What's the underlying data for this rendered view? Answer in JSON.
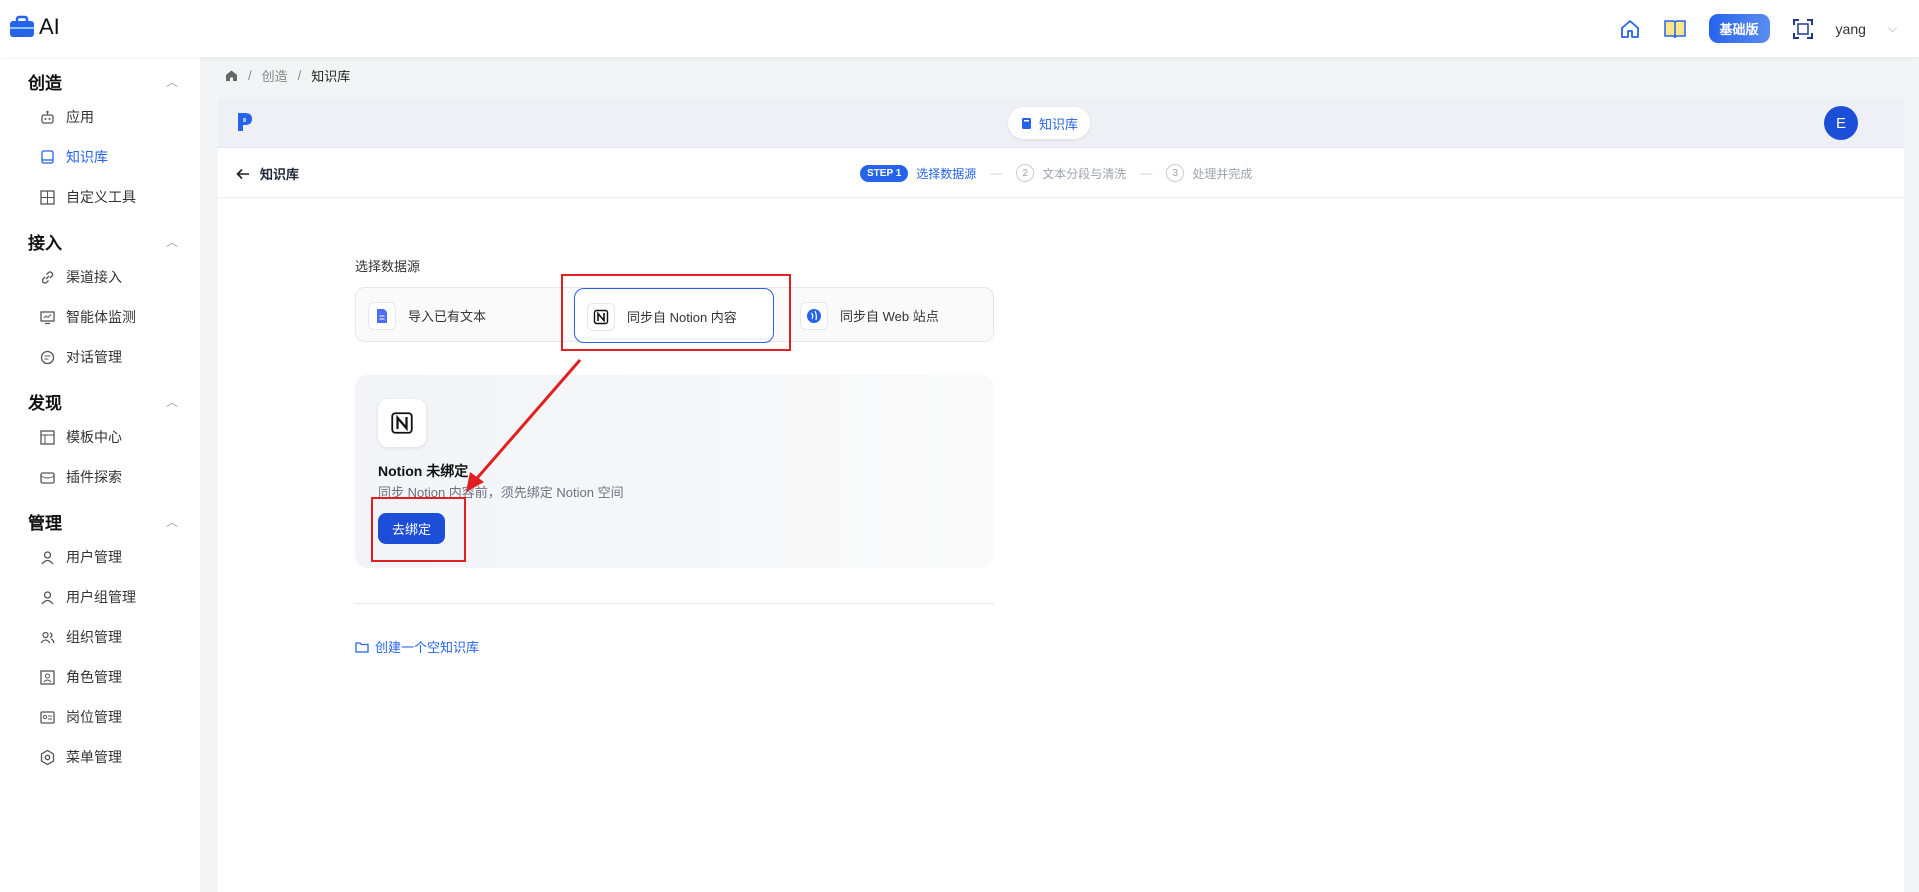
{
  "app": {
    "title": "AI"
  },
  "topbar": {
    "plan_badge": "基础版",
    "username": "yang"
  },
  "sidebar": {
    "groups": [
      {
        "title": "创造",
        "items": [
          {
            "label": "应用",
            "icon": "robot-icon"
          },
          {
            "label": "知识库",
            "icon": "book-icon",
            "active": true
          },
          {
            "label": "自定义工具",
            "icon": "tool-icon"
          }
        ]
      },
      {
        "title": "接入",
        "items": [
          {
            "label": "渠道接入",
            "icon": "link-icon"
          },
          {
            "label": "智能体监测",
            "icon": "monitor-icon"
          },
          {
            "label": "对话管理",
            "icon": "chat-icon"
          }
        ]
      },
      {
        "title": "发现",
        "items": [
          {
            "label": "模板中心",
            "icon": "template-icon"
          },
          {
            "label": "插件探索",
            "icon": "plugin-icon"
          }
        ]
      },
      {
        "title": "管理",
        "items": [
          {
            "label": "用户管理",
            "icon": "user-icon"
          },
          {
            "label": "用户组管理",
            "icon": "user-group-icon"
          },
          {
            "label": "组织管理",
            "icon": "org-icon"
          },
          {
            "label": "角色管理",
            "icon": "role-icon"
          },
          {
            "label": "岗位管理",
            "icon": "post-icon"
          },
          {
            "label": "菜单管理",
            "icon": "menu-gear-icon"
          }
        ]
      }
    ]
  },
  "breadcrumb": {
    "items": [
      "创造",
      "知识库"
    ]
  },
  "header": {
    "pill_label": "知识库",
    "avatar": "E"
  },
  "stepbar": {
    "back_label": "知识库",
    "step_tag": "STEP 1",
    "step1": "选择数据源",
    "step2_num": "2",
    "step2": "文本分段与清洗",
    "step3_num": "3",
    "step3": "处理并完成"
  },
  "datasource": {
    "section_label": "选择数据源",
    "options": [
      "导入已有文本",
      "同步自 Notion 内容",
      "同步自 Web 站点"
    ]
  },
  "notion_card": {
    "title": "Notion 未绑定",
    "description": "同步 Notion 内容前，须先绑定 Notion 空间",
    "button": "去绑定"
  },
  "create_empty": "创建一个空知识库",
  "colors": {
    "accent": "#2563eb",
    "annotation": "#e02020"
  }
}
